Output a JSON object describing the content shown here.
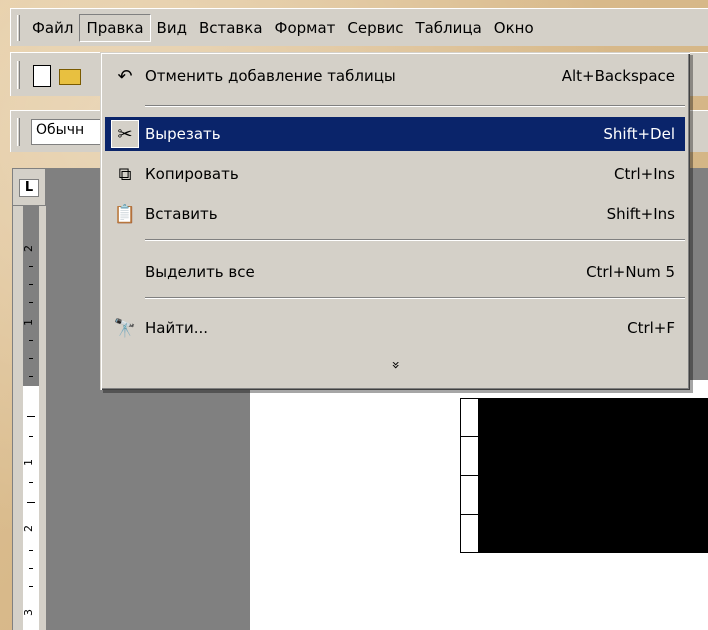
{
  "menubar": {
    "items": [
      {
        "label": "Файл",
        "underline_index": 0
      },
      {
        "label": "Правка",
        "underline_index": 0
      },
      {
        "label": "Вид",
        "underline_index": 0
      },
      {
        "label": "Вставка",
        "underline_index": 3
      },
      {
        "label": "Формат",
        "underline_index": 4
      },
      {
        "label": "Сервис",
        "underline_index": 2
      },
      {
        "label": "Таблица",
        "underline_index": 0
      },
      {
        "label": "Окно",
        "underline_index": 0
      }
    ],
    "open_item": "Правка"
  },
  "toolbar": {
    "style_value": "Обычн"
  },
  "ruler": {
    "corner_label": "L",
    "numbers": [
      "2",
      "1",
      "1",
      "2",
      "3"
    ]
  },
  "edit_menu": {
    "undo": {
      "label": "Отменить добавление таблицы",
      "underline": "О",
      "shortcut": "Alt+Backspace",
      "icon": "undo-icon"
    },
    "cut": {
      "label": "Вырезать",
      "underline": "В",
      "shortcut": "Shift+Del",
      "icon": "scissors-icon",
      "selected": true
    },
    "copy": {
      "label": "Копировать",
      "underline": "К",
      "shortcut": "Ctrl+Ins",
      "icon": "copy-icon"
    },
    "paste": {
      "label": "Вставить",
      "underline": "а",
      "shortcut": "Shift+Ins",
      "icon": "paste-icon"
    },
    "select_all": {
      "label": "Выделить все",
      "underline": "ы",
      "shortcut": "Ctrl+Num 5"
    },
    "find": {
      "label": "Найти...",
      "underline": "Н",
      "shortcut": "Ctrl+F",
      "icon": "binoculars-icon"
    },
    "expand_glyph": "»"
  },
  "colors": {
    "menu_face": "#d4d0c8",
    "selection": "#0a246a",
    "background": "#d8b98a"
  }
}
